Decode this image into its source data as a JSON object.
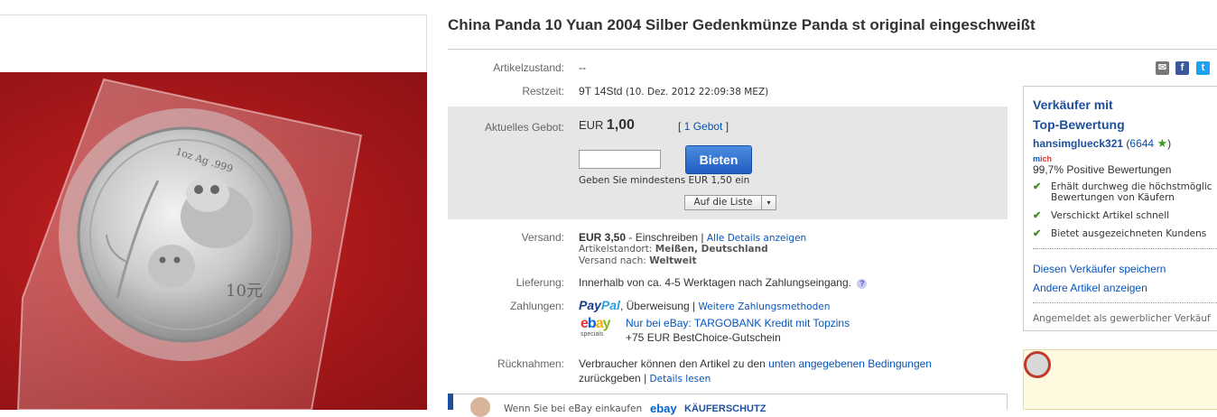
{
  "title": "China Panda 10 Yuan 2004 Silber Gedenkmünze Panda st original eingeschweißt",
  "coin": {
    "weight_text": "1oz Ag .999",
    "denomination": "10元"
  },
  "condition": {
    "label": "Artikelzustand:",
    "value": "--"
  },
  "time_left": {
    "label": "Restzeit:",
    "value": "9T 14Std",
    "end_date": "(10. Dez. 2012 22:09:38 MEZ)"
  },
  "bid": {
    "label": "Aktuelles Gebot:",
    "currency": "EUR",
    "amount": "1,00",
    "bid_count_link": "1 Gebot",
    "bid_open": "[",
    "bid_close": "]",
    "input_value": "",
    "button_label": "Bieten",
    "min_bid_note": "Geben Sie mindestens EUR 1,50 ein",
    "watch_label": "Auf die Liste",
    "watch_arrow": "▾"
  },
  "shipping": {
    "label": "Versand:",
    "price": "EUR 3,50",
    "method": " - Einschreiben ",
    "sep": "|",
    "details_link": "Alle Details anzeigen",
    "location_label": "Artikelstandort:",
    "location_value": "Meißen, Deutschland",
    "ships_to_label": "Versand nach:",
    "ships_to_value": "Weltweit"
  },
  "delivery": {
    "label": "Lieferung:",
    "value": "Innerhalb von ca. 4-5 Werktagen nach Zahlungseingang.",
    "help_icon": "?"
  },
  "payments": {
    "label": "Zahlungen:",
    "paypal_pay": "Pay",
    "paypal_pal": "Pal",
    "transfer": ", Überweisung",
    "sep": "|",
    "more_link": "Weitere Zahlungsmethoden",
    "ebay_e": "e",
    "ebay_b": "b",
    "ebay_a": "a",
    "ebay_y": "y",
    "ebay_sub": "specials",
    "credit_link": "Nur bei eBay: TARGOBANK Kredit mit Topzins",
    "voucher": "+75 EUR BestChoice-Gutschein"
  },
  "returns": {
    "label": "Rücknahmen:",
    "text_before": "Verbraucher können den Artikel zu den ",
    "conditions_link": "unten angegebenen Bedingungen",
    "text_after": "zurückgeben",
    "sep": "|",
    "details_link": "Details lesen"
  },
  "kaeufer": {
    "text": "Wenn Sie bei eBay einkaufen",
    "logo": "ebay",
    "title": "KÄUFERSCHUTZ"
  },
  "seller": {
    "top_rated_line1": "Verkäufer mit",
    "top_rated_line2": "Top-Bewertung",
    "name": "hansimglueck321",
    "score_open": "(",
    "score": "6644",
    "score_close": ")",
    "me_m": "m",
    "me_e": "ich",
    "positive": "99,7% Positive Bewertungen",
    "perks": [
      "Erhält durchweg die höchstmöglic",
      "Bewertungen von Käufern",
      "Verschickt Artikel schnell",
      "Bietet ausgezeichneten Kundens"
    ],
    "save_link": "Diesen Verkäufer speichern",
    "other_items_link": "Andere Artikel anzeigen",
    "business_note": "Angemeldet als gewerblicher Verkäuf"
  },
  "colors": {
    "link": "#0654ba",
    "button": "#2465c9",
    "bid_box": "#e6e6e6",
    "star": "#3a9a1c"
  }
}
